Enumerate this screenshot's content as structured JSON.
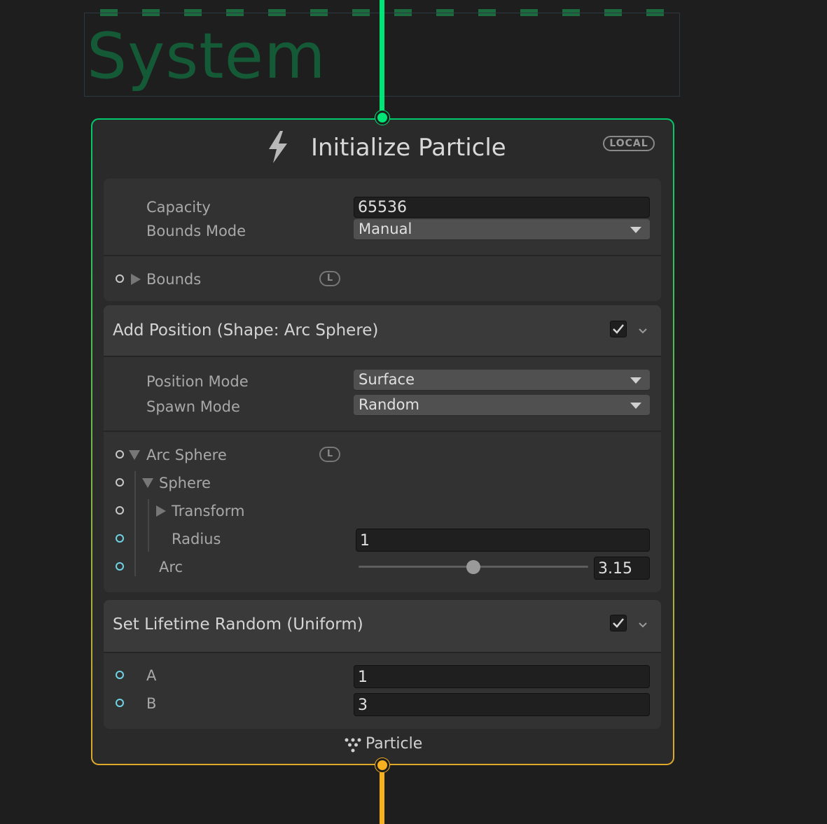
{
  "system": {
    "title": "System"
  },
  "node": {
    "title": "Initialize Particle",
    "space_badge": "LOCAL",
    "capacity_label": "Capacity",
    "capacity_value": "65536",
    "bounds_mode_label": "Bounds Mode",
    "bounds_mode_value": "Manual",
    "bounds_label": "Bounds",
    "bounds_badge": "L",
    "footer_label": "Particle",
    "colors": {
      "input_flow": "#00e676",
      "output_flow": "#f7b11e",
      "system_border": "#1b6b3e"
    }
  },
  "blocks": {
    "add_position": {
      "title": "Add Position (Shape: Arc Sphere)",
      "enabled": true,
      "position_mode_label": "Position Mode",
      "position_mode_value": "Surface",
      "spawn_mode_label": "Spawn Mode",
      "spawn_mode_value": "Random",
      "arc_sphere_label": "Arc Sphere",
      "arc_sphere_badge": "L",
      "sphere_label": "Sphere",
      "transform_label": "Transform",
      "radius_label": "Radius",
      "radius_value": "1",
      "arc_label": "Arc",
      "arc_value": "3.15",
      "arc_slider_fraction": 0.5
    },
    "set_lifetime": {
      "title": "Set Lifetime Random (Uniform)",
      "enabled": true,
      "a_label": "A",
      "a_value": "1",
      "b_label": "B",
      "b_value": "3"
    }
  }
}
